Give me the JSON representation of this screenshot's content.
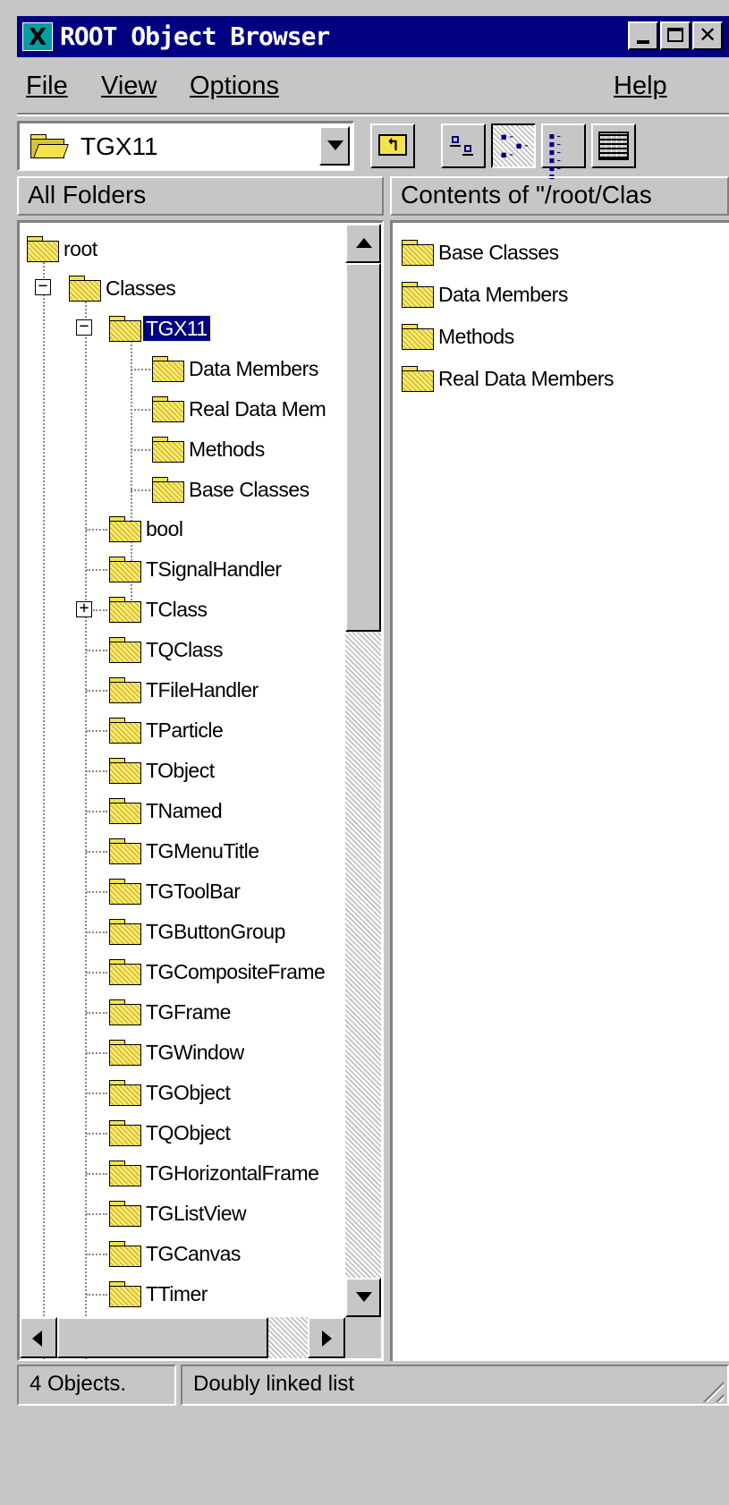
{
  "window": {
    "title": "ROOT Object Browser",
    "icon_letter": "X"
  },
  "menu": {
    "file": "File",
    "view": "View",
    "options": "Options",
    "help": "Help"
  },
  "location_combo": {
    "value": "TGX11"
  },
  "panes": {
    "left_header": "All Folders",
    "right_header": "Contents of \"/root/Clas"
  },
  "tree": {
    "root": "root",
    "classes": "Classes",
    "selected": "TGX11",
    "tgx11_children": [
      "Data Members",
      "Real Data Mem",
      "Methods",
      "Base Classes"
    ],
    "class_items": [
      "bool",
      "TSignalHandler",
      "TClass",
      "TQClass",
      "TFileHandler",
      "TParticle",
      "TObject",
      "TNamed",
      "TGMenuTitle",
      "TGToolBar",
      "TGButtonGroup",
      "TGCompositeFrame",
      "TGFrame",
      "TGWindow",
      "TGObject",
      "TQObject",
      "TGHorizontalFrame",
      "TGListView",
      "TGCanvas",
      "TTimer"
    ]
  },
  "contents": {
    "items": [
      "Base Classes",
      "Data Members",
      "Methods",
      "Real Data Members"
    ]
  },
  "status": {
    "count": "4 Objects.",
    "info": "Doubly linked list"
  },
  "colors": {
    "title_bar": "#000080",
    "chrome": "#c6c6c6",
    "folder": "#f4e24a",
    "selection": "#000080"
  }
}
